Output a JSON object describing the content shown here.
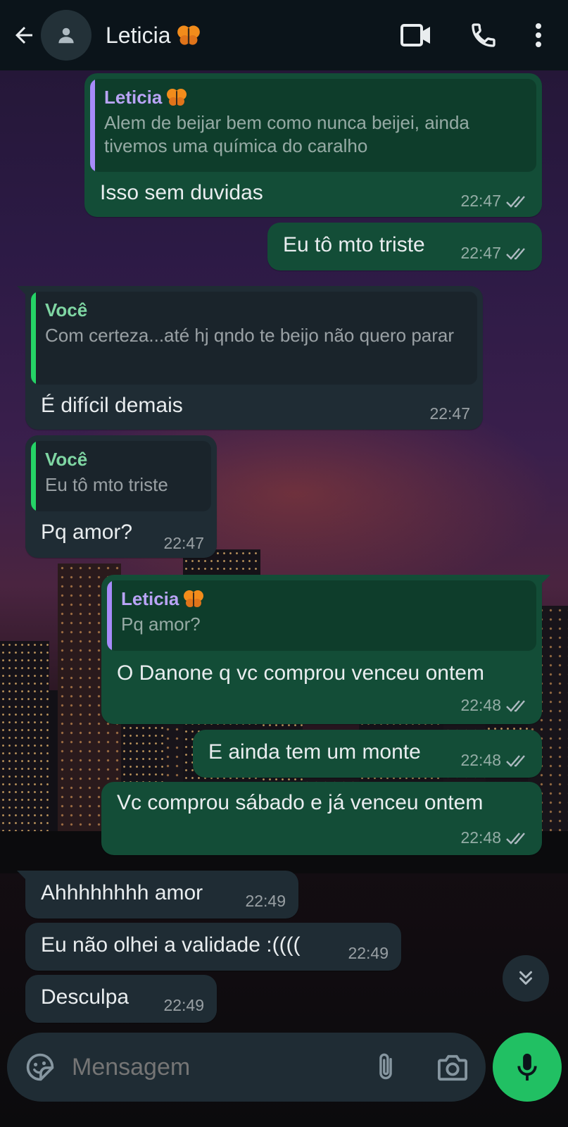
{
  "header": {
    "contact_name": "Leticia",
    "icons": {
      "back": "arrow-left-icon",
      "avatar": "person-icon",
      "video": "video-camera-icon",
      "call": "phone-icon",
      "menu": "more-vertical-icon"
    }
  },
  "colors": {
    "outgoing_bubble": "#134d37",
    "incoming_bubble": "#1f2c34",
    "quote_leticia": "#a78bfa",
    "quote_voce": "#25d366",
    "mic_button": "#21c063"
  },
  "messages": [
    {
      "direction": "out",
      "quote": {
        "author": "Leticia",
        "text": "Alem de beijar bem como nunca beijei, ainda tivemos uma química do caralho"
      },
      "text": "Isso sem duvidas",
      "time": "22:47",
      "status": "read"
    },
    {
      "direction": "out",
      "text": "Eu tô mto triste",
      "time": "22:47",
      "status": "read"
    },
    {
      "direction": "in",
      "quote": {
        "author": "Você",
        "text": "Com certeza...até hj qndo te beijo não quero parar"
      },
      "text": "É difícil demais",
      "time": "22:47"
    },
    {
      "direction": "in",
      "quote": {
        "author": "Você",
        "text": "Eu tô mto triste"
      },
      "text": "Pq amor?",
      "time": "22:47"
    },
    {
      "direction": "out",
      "quote": {
        "author": "Leticia",
        "text": "Pq amor?"
      },
      "text": "O Danone q vc comprou venceu ontem",
      "time": "22:48",
      "status": "read"
    },
    {
      "direction": "out",
      "text": "E ainda tem um monte",
      "time": "22:48",
      "status": "read"
    },
    {
      "direction": "out",
      "text": "Vc comprou sábado e já venceu ontem",
      "time": "22:48",
      "status": "read"
    },
    {
      "direction": "in",
      "text": "Ahhhhhhhh amor",
      "time": "22:49"
    },
    {
      "direction": "in",
      "text": "Eu não olhei a validade :((((",
      "time": "22:49"
    },
    {
      "direction": "in",
      "text": "Desculpa",
      "time": "22:49"
    }
  ],
  "input": {
    "placeholder": "Mensagem",
    "icons": {
      "sticker": "sticker-icon",
      "attach": "paperclip-icon",
      "camera": "camera-icon",
      "mic": "microphone-icon"
    }
  },
  "scroll_button": {
    "icon": "double-chevron-down-icon"
  }
}
